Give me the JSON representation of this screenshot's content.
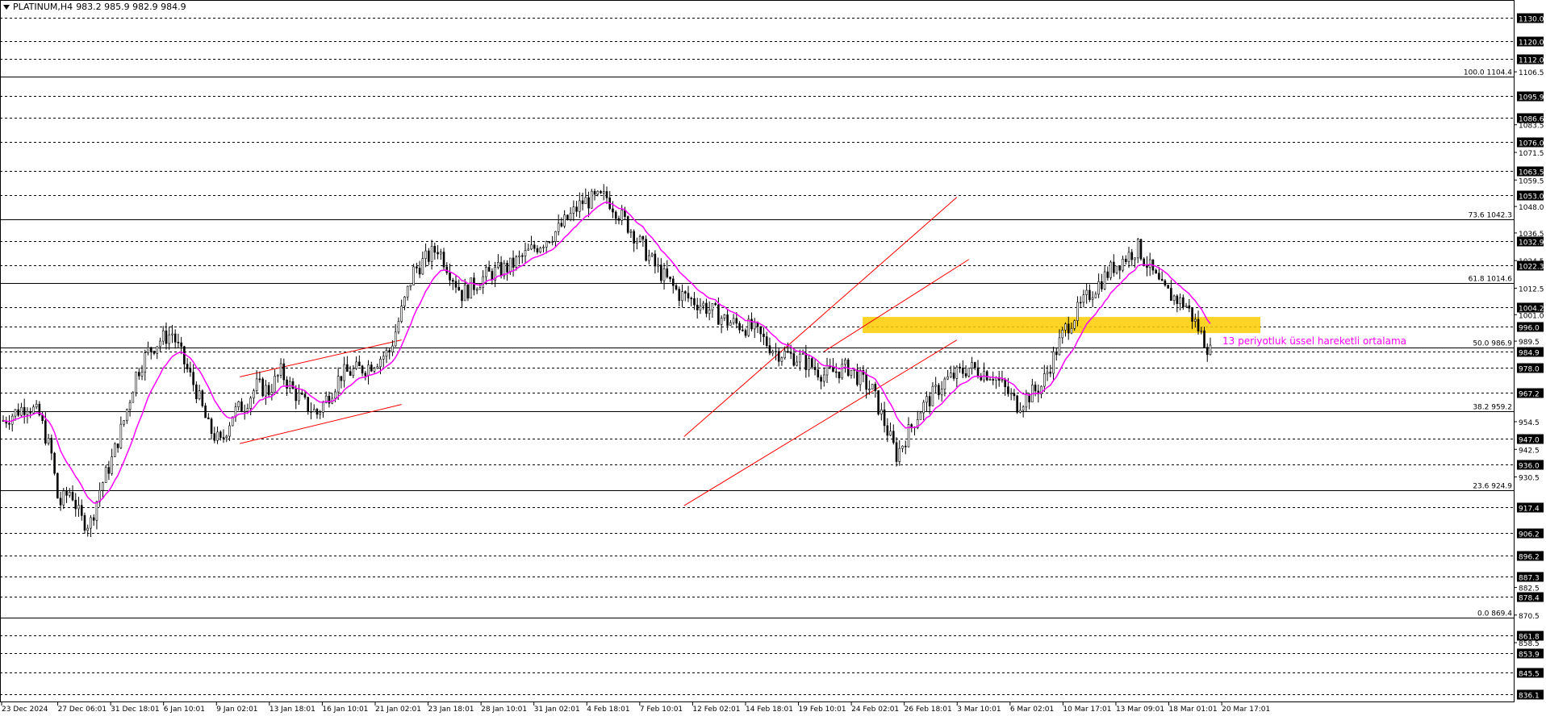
{
  "header": {
    "symbol": "PLATINUM,H4",
    "ohlc": "983.2 985.9 982.9 984.9"
  },
  "colors": {
    "background": "#ffffff",
    "candle": "#000000",
    "ema": "#ff00ff",
    "channel": "#ff0000",
    "zone": "#ffcc00",
    "annotation": "#ff00ff"
  },
  "chart_data": {
    "type": "candlestick",
    "symbol": "PLATINUM",
    "timeframe": "H4",
    "ylim": [
      833.5,
      1141
    ],
    "price_axis_ticks": [
      "1106.5",
      "1083.5",
      "1071.5",
      "1059.5",
      "1048.0",
      "1036.5",
      "1024.5",
      "1012.5",
      "1001.0",
      "989.5",
      "954.5",
      "942.5",
      "930.5",
      "882.5",
      "870.5",
      "858.5"
    ],
    "dashed_levels": [
      1130.0,
      1120.0,
      1112.0,
      1095.9,
      1086.6,
      1076.0,
      1063.5,
      1053.0,
      1032.9,
      1022.3,
      1004.2,
      996.0,
      984.9,
      978.0,
      967.2,
      947.0,
      936.0,
      917.4,
      906.2,
      896.2,
      887.3,
      878.4,
      861.8,
      853.9,
      845.5,
      836.1
    ],
    "boxed_labels": [
      "1130.0",
      "1120.0",
      "1112.0",
      "1095.9",
      "1086.6",
      "1076.0",
      "1063.5",
      "1053.0",
      "1032.9",
      "1022.3",
      "1004.2",
      "996.0",
      "984.9",
      "978.0",
      "967.2",
      "947.0",
      "936.0",
      "917.4",
      "906.2",
      "896.2",
      "887.3",
      "878.4",
      "861.8",
      "853.9",
      "845.5",
      "836.1"
    ],
    "fibonacci": [
      {
        "label": "100.0 1104.4",
        "price": 1104.4
      },
      {
        "label": "73.6 1042.3",
        "price": 1042.3
      },
      {
        "label": "61.8 1014.6",
        "price": 1014.6
      },
      {
        "label": "50.0 986.9",
        "price": 986.9
      },
      {
        "label": "38.2 959.2",
        "price": 959.2
      },
      {
        "label": "23.6 924.9",
        "price": 924.9
      },
      {
        "label": "0.0 869.4",
        "price": 869.4
      }
    ],
    "x_labels": [
      "23 Dec 2024",
      "27 Dec 06:01",
      "31 Dec 18:01",
      "6 Jan 10:01",
      "9 Jan 02:01",
      "13 Jan 18:01",
      "16 Jan 10:01",
      "21 Jan 02:01",
      "23 Jan 18:01",
      "28 Jan 10:01",
      "31 Jan 02:01",
      "4 Feb 18:01",
      "7 Feb 10:01",
      "12 Feb 02:01",
      "14 Feb 18:01",
      "19 Feb 10:01",
      "24 Feb 02:01",
      "26 Feb 18:01",
      "3 Mar 10:01",
      "6 Mar 02:01",
      "10 Mar 17:01",
      "13 Mar 09:01",
      "18 Mar 01:01",
      "20 Mar 17:01"
    ],
    "x_count": 24,
    "close_path": [
      [
        0,
        955
      ],
      [
        1,
        962
      ],
      [
        1.5,
        957
      ],
      [
        2,
        940
      ],
      [
        2.3,
        918
      ],
      [
        2.8,
        925
      ],
      [
        3.2,
        912
      ],
      [
        3.6,
        910
      ],
      [
        4,
        925
      ],
      [
        4.5,
        938
      ],
      [
        5,
        955
      ],
      [
        5.5,
        975
      ],
      [
        6,
        985
      ],
      [
        6.5,
        990
      ],
      [
        7,
        993
      ],
      [
        7.5,
        980
      ],
      [
        8,
        968
      ],
      [
        8.5,
        952
      ],
      [
        9,
        945
      ],
      [
        9.5,
        958
      ],
      [
        10,
        962
      ],
      [
        10.5,
        970
      ],
      [
        11,
        968
      ],
      [
        11.5,
        976
      ],
      [
        12,
        968
      ],
      [
        12.5,
        962
      ],
      [
        13,
        958
      ],
      [
        14,
        975
      ],
      [
        15,
        978
      ],
      [
        16,
        985
      ],
      [
        17,
        1020
      ],
      [
        18,
        1030
      ],
      [
        19,
        1010
      ],
      [
        20,
        1018
      ],
      [
        21,
        1022
      ],
      [
        22,
        1030
      ],
      [
        23,
        1038
      ],
      [
        24,
        1050
      ],
      [
        25,
        1052
      ],
      [
        26,
        1038
      ],
      [
        27,
        1022
      ],
      [
        28,
        1010
      ],
      [
        29,
        1005
      ],
      [
        30,
        998
      ],
      [
        31,
        995
      ],
      [
        32,
        985
      ],
      [
        33,
        982
      ],
      [
        34,
        975
      ],
      [
        35,
        978
      ],
      [
        36,
        968
      ],
      [
        37,
        940
      ],
      [
        38,
        960
      ],
      [
        39,
        972
      ],
      [
        40,
        978
      ],
      [
        41,
        975
      ],
      [
        42,
        962
      ],
      [
        43,
        970
      ],
      [
        44,
        995
      ],
      [
        45,
        1010
      ],
      [
        46,
        1022
      ],
      [
        47,
        1030
      ],
      [
        48,
        1012
      ],
      [
        49,
        1005
      ],
      [
        50,
        984.9
      ]
    ],
    "ema_period": 13,
    "annotation": "13 periyotluk üssel hareketli ortalama"
  }
}
